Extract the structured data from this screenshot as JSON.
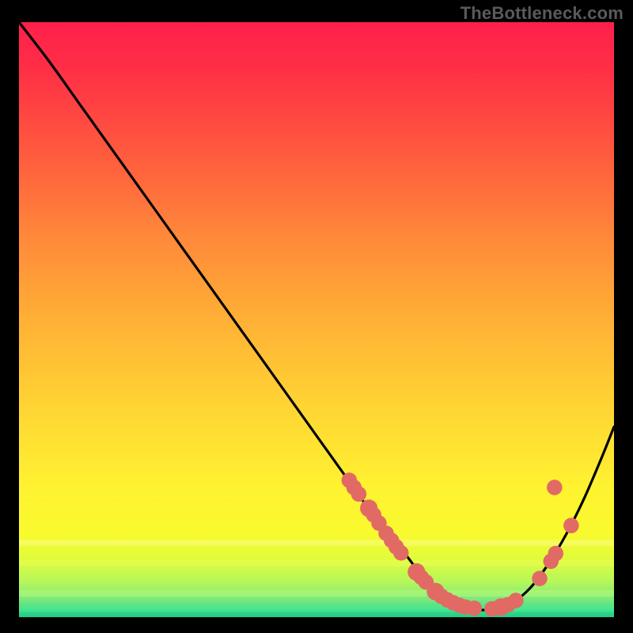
{
  "watermark": "TheBottleneck.com",
  "chart_data": {
    "type": "line",
    "title": "",
    "xlabel": "",
    "ylabel": "",
    "xlim": [
      0,
      100
    ],
    "ylim": [
      0,
      100
    ],
    "grid": false,
    "legend": false,
    "series": [
      {
        "name": "curve",
        "color": "#000000",
        "x": [
          0,
          5,
          10,
          15,
          20,
          25,
          30,
          35,
          40,
          45,
          50,
          55,
          60,
          62,
          65,
          68,
          70,
          73,
          76,
          78,
          80,
          83,
          86,
          89,
          92,
          95,
          98,
          100
        ],
        "y": [
          100,
          93.5,
          86.5,
          79.5,
          72.5,
          65.5,
          58.5,
          51.5,
          44.5,
          37.5,
          30.5,
          23.5,
          16.5,
          14,
          10.5,
          6.5,
          4.5,
          2.5,
          1.5,
          1.2,
          1.5,
          2.5,
          5,
          9,
          14,
          20,
          27,
          32
        ]
      }
    ],
    "markers": [
      {
        "x": 55.5,
        "y": 23.0,
        "r": 1.0
      },
      {
        "x": 56.3,
        "y": 21.8,
        "r": 1.0
      },
      {
        "x": 57.1,
        "y": 20.7,
        "r": 1.0
      },
      {
        "x": 58.8,
        "y": 18.3,
        "r": 1.2
      },
      {
        "x": 59.6,
        "y": 17.2,
        "r": 1.0
      },
      {
        "x": 60.5,
        "y": 15.8,
        "r": 1.0
      },
      {
        "x": 61.7,
        "y": 14.1,
        "r": 1.0
      },
      {
        "x": 62.6,
        "y": 12.9,
        "r": 1.0
      },
      {
        "x": 63.4,
        "y": 11.8,
        "r": 1.0
      },
      {
        "x": 64.2,
        "y": 10.8,
        "r": 1.0
      },
      {
        "x": 66.8,
        "y": 7.6,
        "r": 1.2
      },
      {
        "x": 67.6,
        "y": 6.7,
        "r": 1.0
      },
      {
        "x": 68.4,
        "y": 5.9,
        "r": 1.0
      },
      {
        "x": 70.0,
        "y": 4.3,
        "r": 1.2
      },
      {
        "x": 71.0,
        "y": 3.5,
        "r": 1.0
      },
      {
        "x": 72.0,
        "y": 2.9,
        "r": 1.0
      },
      {
        "x": 73.0,
        "y": 2.4,
        "r": 1.0
      },
      {
        "x": 74.0,
        "y": 2.0,
        "r": 1.0
      },
      {
        "x": 75.0,
        "y": 1.7,
        "r": 1.0
      },
      {
        "x": 76.5,
        "y": 1.5,
        "r": 1.0
      },
      {
        "x": 79.5,
        "y": 1.4,
        "r": 1.0
      },
      {
        "x": 81.0,
        "y": 1.7,
        "r": 1.2
      },
      {
        "x": 82.2,
        "y": 2.1,
        "r": 1.0
      },
      {
        "x": 83.5,
        "y": 2.8,
        "r": 1.0
      },
      {
        "x": 87.5,
        "y": 6.5,
        "r": 1.0
      },
      {
        "x": 89.4,
        "y": 9.4,
        "r": 1.0
      },
      {
        "x": 90.2,
        "y": 10.7,
        "r": 1.0
      },
      {
        "x": 92.8,
        "y": 15.4,
        "r": 1.0
      },
      {
        "x": 90.0,
        "y": 21.8,
        "r": 1.0
      }
    ],
    "marker_color": "#e26a65",
    "bright_bands": [
      {
        "y_pct": 87.5,
        "color": "#ffffaa"
      },
      {
        "y_pct": 91.0,
        "color": "#f4ff5d"
      },
      {
        "y_pct": 96.0,
        "color": "#ccff80"
      },
      {
        "y_pct": 98.5,
        "color": "#4ef598"
      }
    ]
  }
}
